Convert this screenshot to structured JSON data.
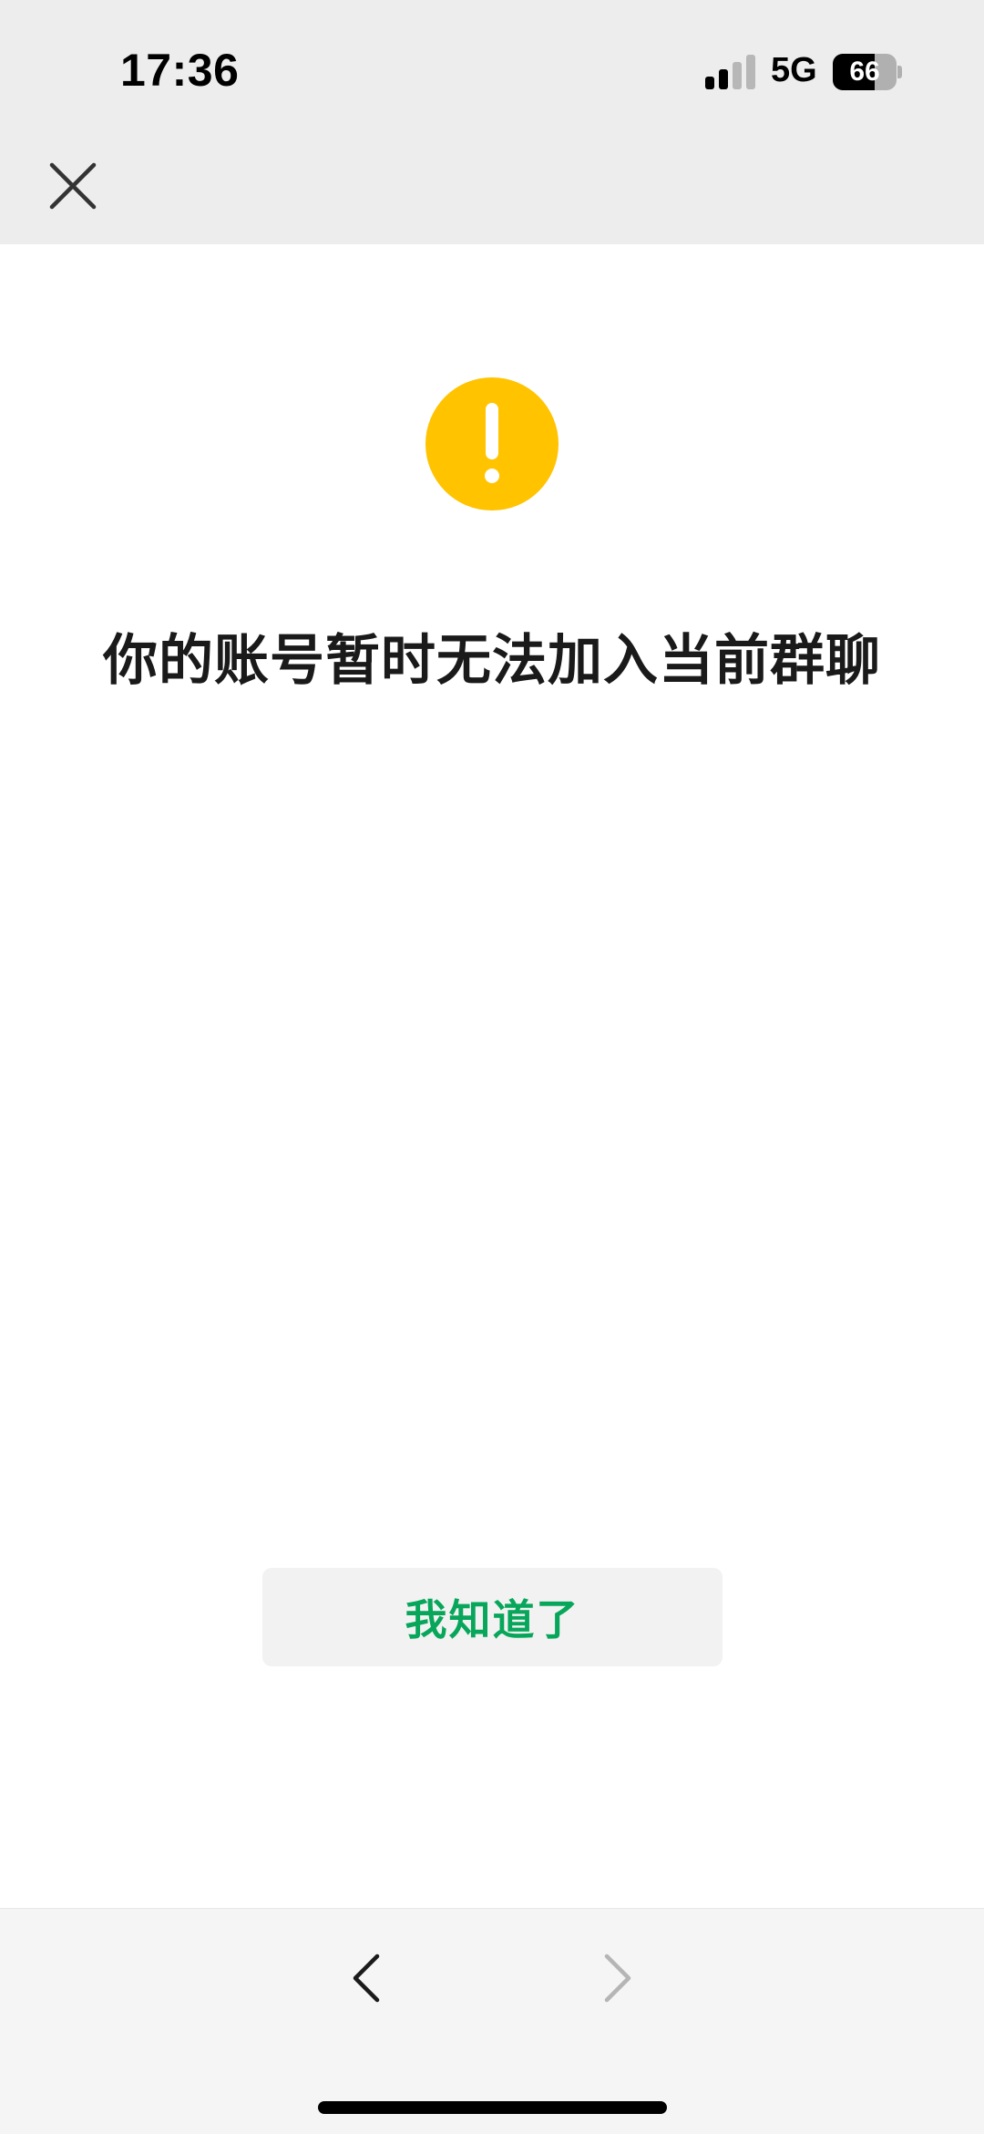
{
  "status_bar": {
    "time": "17:36",
    "network": "5G",
    "battery_level": "66",
    "battery_fraction": 0.66,
    "signal_bars_active": 2,
    "signal_bars_total": 4
  },
  "nav": {
    "close_icon": "close-icon"
  },
  "main": {
    "warning_icon": "exclamation-circle-icon",
    "warning_color": "#FFC300",
    "message": "你的账号暂时无法加入当前群聊",
    "button_label": "我知道了",
    "button_text_color": "#07A65A",
    "button_bg_color": "#F2F2F2"
  },
  "toolbar": {
    "back_icon": "chevron-left-icon",
    "forward_icon": "chevron-right-icon",
    "forward_enabled": false
  }
}
